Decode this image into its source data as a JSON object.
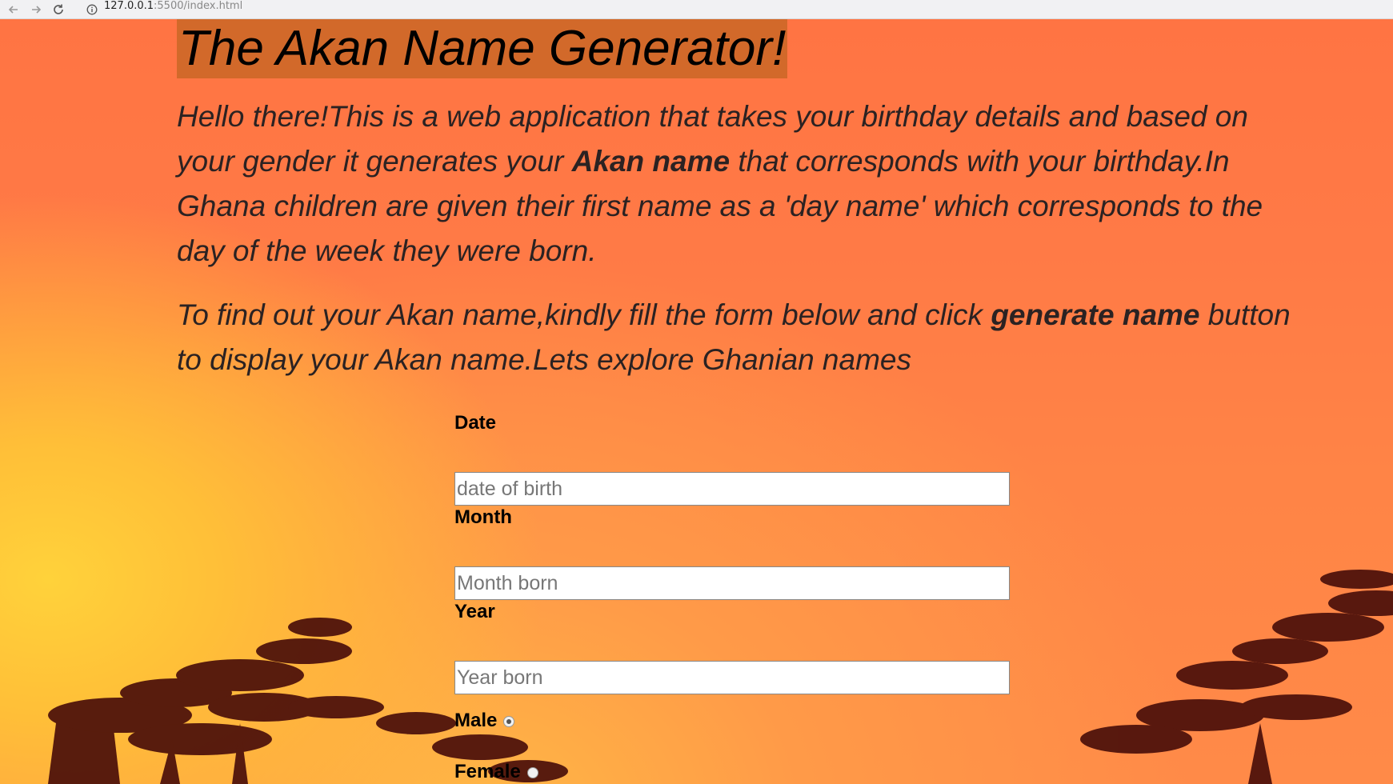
{
  "browser": {
    "url_host": "127.0.0.1",
    "url_rest": ":5500/index.html"
  },
  "page": {
    "title": "The Akan Name Generator!",
    "intro": {
      "part1": "Hello there!This is a web application that takes your birthday details and based on your gender it generates your ",
      "bold": "Akan name",
      "part2": " that corresponds with your birthday.In Ghana children are given their first name as a 'day name' which corresponds to the day of the week they were born."
    },
    "instructions": {
      "part1": "To find out your Akan name,kindly fill the form below and click ",
      "bold": "generate name",
      "part2": " button to display your Akan name.Lets explore Ghanian names"
    }
  },
  "form": {
    "date": {
      "label": "Date",
      "placeholder": "date of birth",
      "value": ""
    },
    "month": {
      "label": "Month",
      "placeholder": "Month born",
      "value": ""
    },
    "year": {
      "label": "Year",
      "placeholder": "Year born",
      "value": ""
    },
    "gender": {
      "male_label": "Male",
      "female_label": "Female",
      "male_checked": true,
      "female_checked": false
    }
  },
  "icons": {
    "back": "arrow-left-icon",
    "forward": "arrow-right-icon",
    "reload": "reload-icon",
    "info": "info-icon"
  }
}
